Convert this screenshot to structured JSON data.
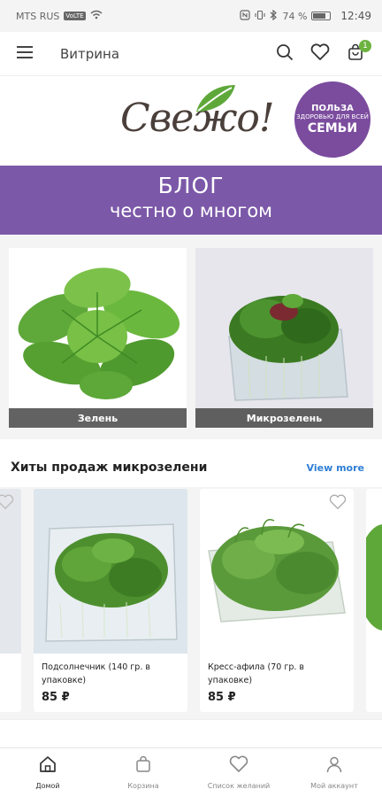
{
  "status_bar": {
    "carrier": "MTS RUS",
    "network_badge": "VoLTE",
    "battery": "74 %",
    "time": "12:49"
  },
  "app_bar": {
    "title": "Витрина",
    "cart_count": "1",
    "icons": [
      "menu-icon",
      "search-icon",
      "heart-icon",
      "cart-icon"
    ]
  },
  "logo": {
    "text": "Свежо!",
    "badge_line1": "ПОЛЬЗА",
    "badge_line2": "ЗДОРОВЬЮ ДЛЯ ВСЕЙ",
    "badge_line3": "СЕМЬИ"
  },
  "blog_banner": {
    "title": "БЛОГ",
    "subtitle": "честно о многом"
  },
  "categories": [
    {
      "label": "Зелень"
    },
    {
      "label": "Микрозелень"
    }
  ],
  "section": {
    "title": "Хиты продаж микрозелени",
    "view_more": "View more"
  },
  "products": [
    {
      "name": "Подсолнечник (140 гр. в упаковке)",
      "price": "85 ₽"
    },
    {
      "name": "Кресс-афила (70 гр. в упаковке)",
      "price": "85 ₽"
    }
  ],
  "bottom_nav": [
    {
      "label": "Домой",
      "icon": "home-icon"
    },
    {
      "label": "Корзина",
      "icon": "bag-icon"
    },
    {
      "label": "Список желаний",
      "icon": "heart-icon"
    },
    {
      "label": "Мой аккаунт",
      "icon": "user-icon"
    }
  ],
  "colors": {
    "accent_purple": "#7b58a8",
    "badge_purple": "#7b4c9e",
    "link_blue": "#2f7fd6",
    "cart_badge_green": "#6db33f"
  }
}
